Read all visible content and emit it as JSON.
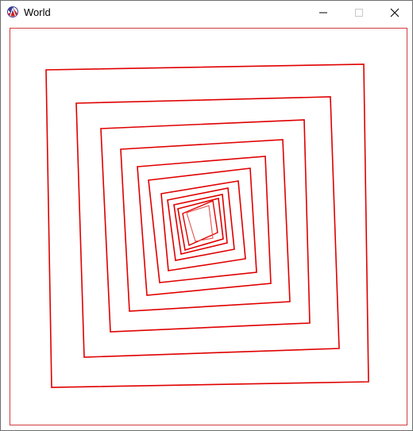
{
  "window": {
    "title": "World",
    "app_icon": "racket-logo-icon",
    "controls": [
      "minimize-icon",
      "maximize-icon",
      "close-icon"
    ]
  },
  "colors": {
    "stroke": "#e00000",
    "border": "#d23c3c"
  }
}
